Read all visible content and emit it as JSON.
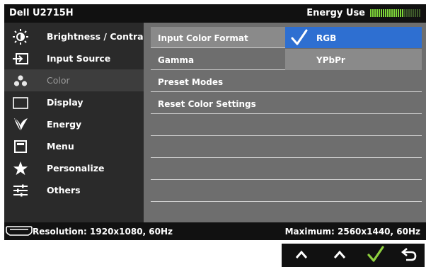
{
  "header": {
    "model": "Dell U2715H",
    "energy_label": "Energy Use",
    "energy_level_fraction": 0.65
  },
  "sidebar": {
    "items": [
      {
        "label": "Brightness / Contrast",
        "icon": "brightness-icon"
      },
      {
        "label": "Input Source",
        "icon": "input-source-icon"
      },
      {
        "label": "Color",
        "icon": "color-icon",
        "selected": true
      },
      {
        "label": "Display",
        "icon": "display-icon"
      },
      {
        "label": "Energy",
        "icon": "energy-leaf-icon"
      },
      {
        "label": "Menu",
        "icon": "menu-icon"
      },
      {
        "label": "Personalize",
        "icon": "star-icon"
      },
      {
        "label": "Others",
        "icon": "others-sliders-icon"
      }
    ]
  },
  "submenu": {
    "items": [
      {
        "label": "Input Color Format",
        "active": true
      },
      {
        "label": "Gamma"
      },
      {
        "label": "Preset Modes"
      },
      {
        "label": "Reset Color Settings"
      }
    ],
    "options": [
      {
        "label": "RGB",
        "selected": true
      },
      {
        "label": "YPbPr",
        "selected": false
      }
    ]
  },
  "status": {
    "resolution": "Resolution: 1920x1080, 60Hz",
    "maximum": "Maximum: 2560x1440, 60Hz"
  },
  "buttons": [
    {
      "icon": "chevron-up-icon"
    },
    {
      "icon": "chevron-up-icon"
    },
    {
      "icon": "check-icon"
    },
    {
      "icon": "back-icon"
    }
  ],
  "colors": {
    "osd_bg": "#2a2a2a",
    "title_bg": "#111111",
    "submenu_bg": "#6e6e6e",
    "selected_option": "#2e6fd1",
    "meter_on": "#7fd63a",
    "check_green": "#8fd13f"
  }
}
